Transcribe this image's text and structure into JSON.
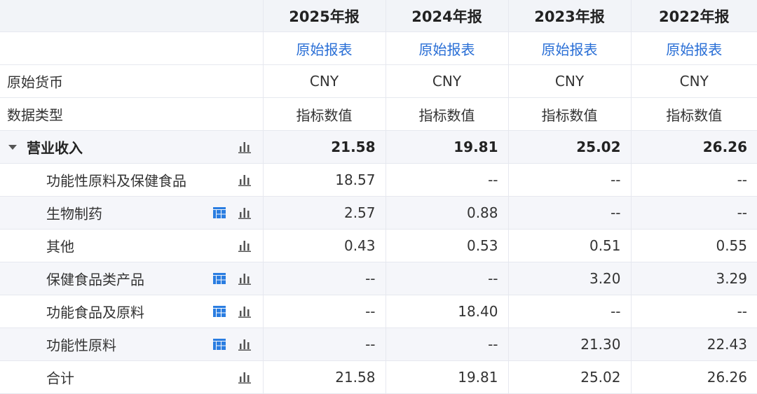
{
  "periods": [
    "2025年报",
    "2024年报",
    "2023年报",
    "2022年报"
  ],
  "report_link_label": "原始报表",
  "currency_row": {
    "label": "原始货币",
    "values": [
      "CNY",
      "CNY",
      "CNY",
      "CNY"
    ]
  },
  "type_row": {
    "label": "数据类型",
    "values": [
      "指标数值",
      "指标数值",
      "指标数值",
      "指标数值"
    ]
  },
  "group": {
    "label": "营业收入",
    "values": [
      "21.58",
      "19.81",
      "25.02",
      "26.26"
    ]
  },
  "items": [
    {
      "label": "功能性原料及保健食品",
      "has_grid": false,
      "values": [
        "18.57",
        "--",
        "--",
        "--"
      ]
    },
    {
      "label": "生物制药",
      "has_grid": true,
      "values": [
        "2.57",
        "0.88",
        "--",
        "--"
      ]
    },
    {
      "label": "其他",
      "has_grid": false,
      "values": [
        "0.43",
        "0.53",
        "0.51",
        "0.55"
      ]
    },
    {
      "label": "保健食品类产品",
      "has_grid": true,
      "values": [
        "--",
        "--",
        "3.20",
        "3.29"
      ]
    },
    {
      "label": "功能食品及原料",
      "has_grid": true,
      "values": [
        "--",
        "18.40",
        "--",
        "--"
      ]
    },
    {
      "label": "功能性原料",
      "has_grid": true,
      "values": [
        "--",
        "--",
        "21.30",
        "22.43"
      ]
    },
    {
      "label": "合计",
      "has_grid": false,
      "values": [
        "21.58",
        "19.81",
        "25.02",
        "26.26"
      ]
    }
  ],
  "icons": {
    "chart": "bar-chart-icon",
    "grid": "grid-table-icon",
    "collapse": "caret-down-icon"
  },
  "colors": {
    "link": "#2a6fd6",
    "icon": "#2a7de1",
    "chart_icon": "#555555"
  }
}
